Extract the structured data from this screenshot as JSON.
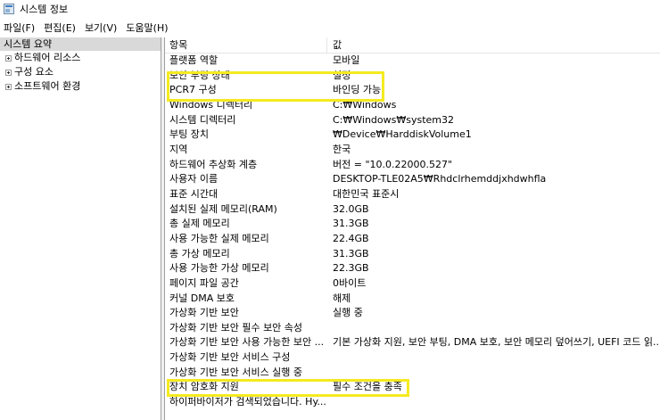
{
  "window": {
    "title": "시스템 정보"
  },
  "menu": [
    "파일(F)",
    "편집(E)",
    "보기(V)",
    "도움말(H)"
  ],
  "tree": {
    "root": "시스템 요약",
    "children": [
      "하드웨어 리소스",
      "구성 요소",
      "소프트웨어 환경"
    ]
  },
  "table": {
    "headers": {
      "item": "항목",
      "value": "값"
    },
    "rows": [
      {
        "item": "플랫폼 역할",
        "value": "모바일"
      },
      {
        "item": "보안 부팅 상태",
        "value": "설정"
      },
      {
        "item": "PCR7 구성",
        "value": "바인딩 가능"
      },
      {
        "item": "Windows 디렉터리",
        "value": "C:₩Windows"
      },
      {
        "item": "시스템 디렉터리",
        "value": "C:₩Windows₩system32"
      },
      {
        "item": "부팅 장치",
        "value": "₩Device₩HarddiskVolume1"
      },
      {
        "item": "지역",
        "value": "한국"
      },
      {
        "item": "하드웨어 추상화 계층",
        "value": "버전 = \"10.0.22000.527\""
      },
      {
        "item": "사용자 이름",
        "value": "DESKTOP-TLE02A5₩Rhdclrhemddjxhdwhfla"
      },
      {
        "item": "표준 시간대",
        "value": "대한민국 표준시"
      },
      {
        "item": "설치된 실제 메모리(RAM)",
        "value": "32.0GB"
      },
      {
        "item": "총 실제 메모리",
        "value": "31.3GB"
      },
      {
        "item": "사용 가능한 실제 메모리",
        "value": "22.4GB"
      },
      {
        "item": "총 가상 메모리",
        "value": "31.3GB"
      },
      {
        "item": "사용 가능한 가상 메모리",
        "value": "22.3GB"
      },
      {
        "item": "페이지 파일 공간",
        "value": "0바이트"
      },
      {
        "item": "커널 DMA 보호",
        "value": "해제"
      },
      {
        "item": "가상화 기반 보안",
        "value": "실행 중"
      },
      {
        "item": "가상화 기반 보안 필수 보안 속성",
        "value": ""
      },
      {
        "item": "가상화 기반 보안 사용 가능한 보안 ...",
        "value": "기본 가상화 지원, 보안 부팅, DMA 보호, 보안 메모리 덮어쓰기, UEFI 코드 읽..."
      },
      {
        "item": "가상화 기반 보안 서비스 구성",
        "value": ""
      },
      {
        "item": "가상화 기반 보안 서비스 실행 중",
        "value": ""
      },
      {
        "item": "장치 암호화 지원",
        "value": "필수 조건을 충족"
      },
      {
        "item": "하이퍼바이저가 검색되었습니다. Hy...",
        "value": ""
      }
    ]
  },
  "highlight_color": "#f5ea1f"
}
